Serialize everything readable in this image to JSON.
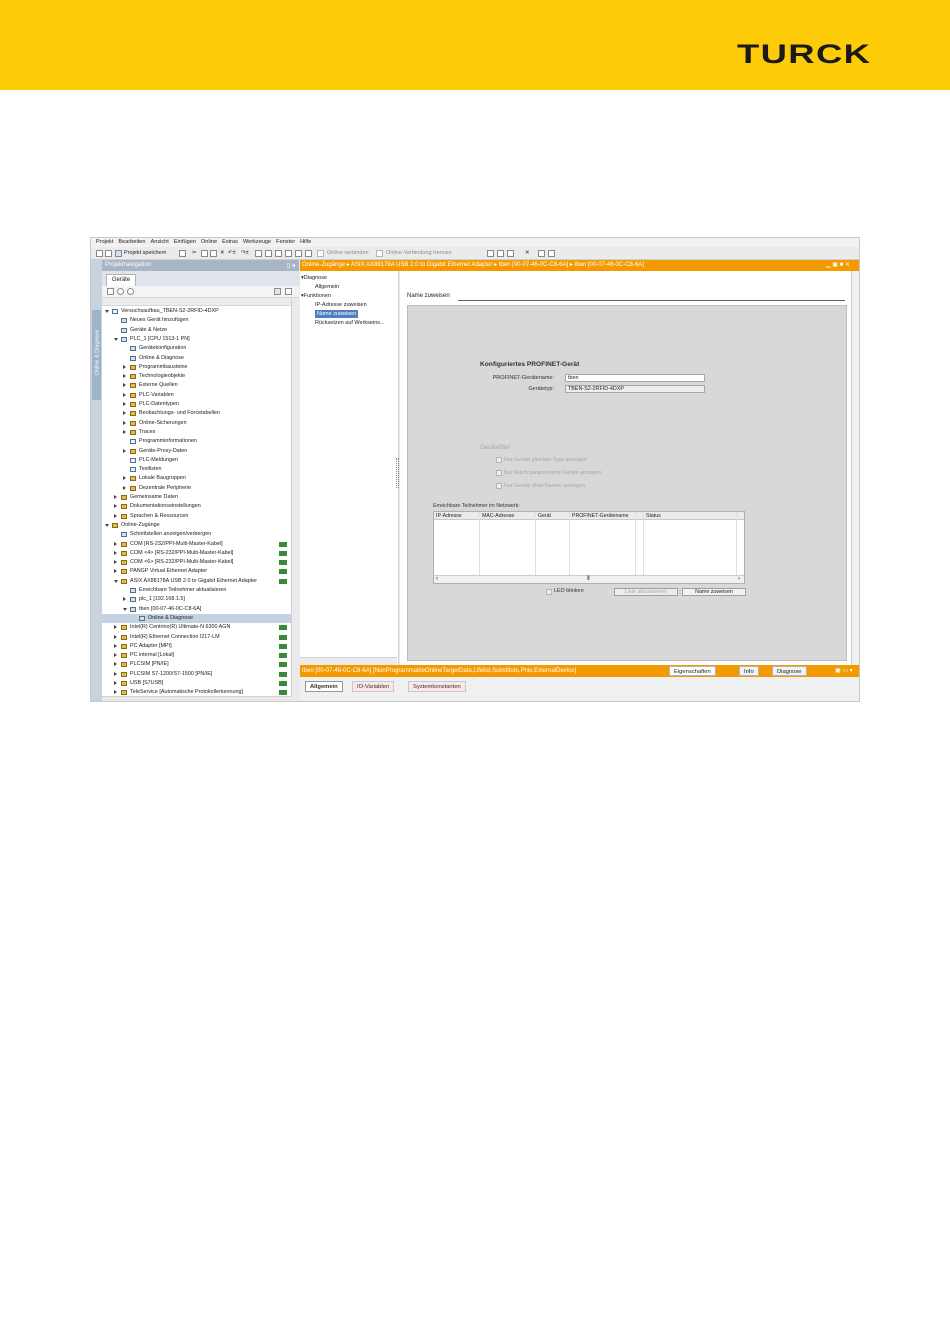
{
  "brand": {
    "logo_text": "TURCK",
    "header_color": "#fecb08"
  },
  "menu": [
    "Projekt",
    "Bearbeiten",
    "Ansicht",
    "Einfügen",
    "Online",
    "Extras",
    "Werkzeuge",
    "Fenster",
    "Hilfe"
  ],
  "toolbar": {
    "save_label": "Projekt speichern",
    "go_online_label": "Online verbinden",
    "go_offline_label": "Online-Verbindung trennen"
  },
  "sidestrip": {
    "label": "Online & Diagnose"
  },
  "nav": {
    "title": "Projektnavigation",
    "tab": "Geräte",
    "tree": [
      {
        "label": "Versuchsaufbau_TBEN-S2-2RFID-4DXP",
        "indent": 0,
        "state": "e",
        "icon": "doc"
      },
      {
        "label": "Neues Gerät hinzufügen",
        "indent": 1,
        "state": "",
        "icon": "pc"
      },
      {
        "label": "Geräte & Netze",
        "indent": 1,
        "state": "",
        "icon": "pc"
      },
      {
        "label": "PLC_1 [CPU 1513-1 PN]",
        "indent": 1,
        "state": "e",
        "icon": "pc"
      },
      {
        "label": "Gerätekonfiguration",
        "indent": 2,
        "state": "",
        "icon": "pc"
      },
      {
        "label": "Online & Diagnose",
        "indent": 2,
        "state": "",
        "icon": "pc"
      },
      {
        "label": "Programmbausteine",
        "indent": 2,
        "state": "c",
        "icon": "f"
      },
      {
        "label": "Technologieobjekte",
        "indent": 2,
        "state": "c",
        "icon": "f"
      },
      {
        "label": "Externe Quellen",
        "indent": 2,
        "state": "c",
        "icon": "f"
      },
      {
        "label": "PLC-Variablen",
        "indent": 2,
        "state": "c",
        "icon": "f"
      },
      {
        "label": "PLC-Datentypen",
        "indent": 2,
        "state": "c",
        "icon": "f"
      },
      {
        "label": "Beobachtungs- und Forcetabellen",
        "indent": 2,
        "state": "c",
        "icon": "f"
      },
      {
        "label": "Online-Sicherungen",
        "indent": 2,
        "state": "c",
        "icon": "f"
      },
      {
        "label": "Traces",
        "indent": 2,
        "state": "c",
        "icon": "f"
      },
      {
        "label": "Programminformationen",
        "indent": 2,
        "state": "",
        "icon": "doc"
      },
      {
        "label": "Geräte-Proxy-Daten",
        "indent": 2,
        "state": "c",
        "icon": "f"
      },
      {
        "label": "PLC-Meldungen",
        "indent": 2,
        "state": "",
        "icon": "doc"
      },
      {
        "label": "Textlisten",
        "indent": 2,
        "state": "",
        "icon": "doc"
      },
      {
        "label": "Lokale Baugruppen",
        "indent": 2,
        "state": "c",
        "icon": "f"
      },
      {
        "label": "Dezentrale Peripherie",
        "indent": 2,
        "state": "c",
        "icon": "f"
      },
      {
        "label": "Gemeinsame Daten",
        "indent": 1,
        "state": "c",
        "icon": "f"
      },
      {
        "label": "Dokumentationseinstellungen",
        "indent": 1,
        "state": "c",
        "icon": "f"
      },
      {
        "label": "Sprachen & Ressourcen",
        "indent": 1,
        "state": "c",
        "icon": "f"
      },
      {
        "label": "Online-Zugänge",
        "indent": 0,
        "state": "e",
        "icon": "f"
      },
      {
        "label": "Schnittstellen anzeigen/verbergen",
        "indent": 1,
        "state": "",
        "icon": "pc"
      },
      {
        "label": "COM [RS-232/PPI-Multi-Master-Kabel]",
        "indent": 1,
        "state": "c",
        "icon": "f",
        "status": true
      },
      {
        "label": "COM <4> [RS-232/PPI-Multi-Master-Kabel]",
        "indent": 1,
        "state": "c",
        "icon": "f",
        "status": true
      },
      {
        "label": "COM <6> [RS-232/PPI-Multi-Master-Kabel]",
        "indent": 1,
        "state": "c",
        "icon": "f",
        "status": true
      },
      {
        "label": "PANGP Virtual Ethernet Adapter",
        "indent": 1,
        "state": "c",
        "icon": "f",
        "status": true
      },
      {
        "label": "ASIX AX88178A USB 2.0 to Gigabit Ethernet Adapter",
        "indent": 1,
        "state": "e",
        "icon": "f",
        "status": true
      },
      {
        "label": "Erreichbare Teilnehmer aktualisieren",
        "indent": 2,
        "state": "",
        "icon": "pc"
      },
      {
        "label": "plc_1 [192.168.1.5]",
        "indent": 2,
        "state": "c",
        "icon": "pc"
      },
      {
        "label": "tben [00-07-46-0C-C8-6A]",
        "indent": 2,
        "state": "e",
        "icon": "pc"
      },
      {
        "label": "Online & Diagnose",
        "indent": 3,
        "state": "",
        "icon": "pc",
        "selected": true
      },
      {
        "label": "Intel(R) Centrino(R) Ultimate-N 6300 AGN",
        "indent": 1,
        "state": "c",
        "icon": "f",
        "status": true
      },
      {
        "label": "Intel(R) Ethernet Connection I217-LM",
        "indent": 1,
        "state": "c",
        "icon": "f",
        "status": true
      },
      {
        "label": "PC Adapter [MPI]",
        "indent": 1,
        "state": "c",
        "icon": "f",
        "status": true
      },
      {
        "label": "PC internal [Lokal]",
        "indent": 1,
        "state": "c",
        "icon": "f",
        "status": true
      },
      {
        "label": "PLCSIM [PN/IE]",
        "indent": 1,
        "state": "c",
        "icon": "f",
        "status": true
      },
      {
        "label": "PLCSIM S7-1200/S7-1500 [PN/IE]",
        "indent": 1,
        "state": "c",
        "icon": "f",
        "status": true
      },
      {
        "label": "USB [S7USB]",
        "indent": 1,
        "state": "c",
        "icon": "f",
        "status": true
      },
      {
        "label": "TeleService [Automatische Protokollerkennung]",
        "indent": 1,
        "state": "c",
        "icon": "f",
        "status": true
      }
    ]
  },
  "editor": {
    "breadcrumb": "Online-Zugänge  ▸  ASIX AX88178A USB 2.0 to Gigabit Ethernet Adapter  ▸  tben [00-07-46-0C-C8-6A]  ▸  tben [00-07-46-0C-C8-6A]",
    "functions": [
      {
        "label": "Diagnose",
        "indent": 0,
        "state": "e"
      },
      {
        "label": "Allgemein",
        "indent": 1,
        "state": ""
      },
      {
        "label": "Funktionen",
        "indent": 0,
        "state": "e"
      },
      {
        "label": "IP-Adresse zuweisen",
        "indent": 1,
        "state": ""
      },
      {
        "label": "Name zuweisen",
        "indent": 1,
        "state": "",
        "selected": true
      },
      {
        "label": "Rücksetzen auf Werkseins...",
        "indent": 1,
        "state": ""
      }
    ],
    "section_title": "Name zuweisen",
    "configured_title": "Konfiguriertes PROFINET-Gerät",
    "device_name_label": "PROFINET-Gerätename:",
    "device_name_value": "tben",
    "device_type_label": "Gerätetyp:",
    "device_type_value": "TBEN-S2-2RFID-4DXP",
    "filter_title": "Gerätefilter",
    "filters": [
      "Nur Geräte gleichen Typs anzeigen",
      "Nur falsch parametrierte Geräte anzeigen",
      "Nur Geräte ohne Namen anzeigen"
    ],
    "reachable_label": "Erreichbare Teilnehmer im Netzwerk:",
    "grid_columns": [
      "IP-Adresse",
      "MAC-Adresse",
      "Gerät",
      "PROFINET-Gerätename",
      "Status"
    ],
    "led_label": "LED blinken",
    "refresh_button": "Liste aktualisieren",
    "assign_button": "Name zuweisen"
  },
  "bottom": {
    "title": "tben [00-07-46-0C-C8-6A]  [NonProgrammableOnlineTargetData,Lifelist,Substitute,Pnio,ExternalDevice]",
    "tabs": [
      "Eigenschaften",
      "Info",
      "Diagnose"
    ],
    "prop_tabs": [
      "Allgemein",
      "IO-Variablen",
      "Systemkonstanten"
    ]
  }
}
